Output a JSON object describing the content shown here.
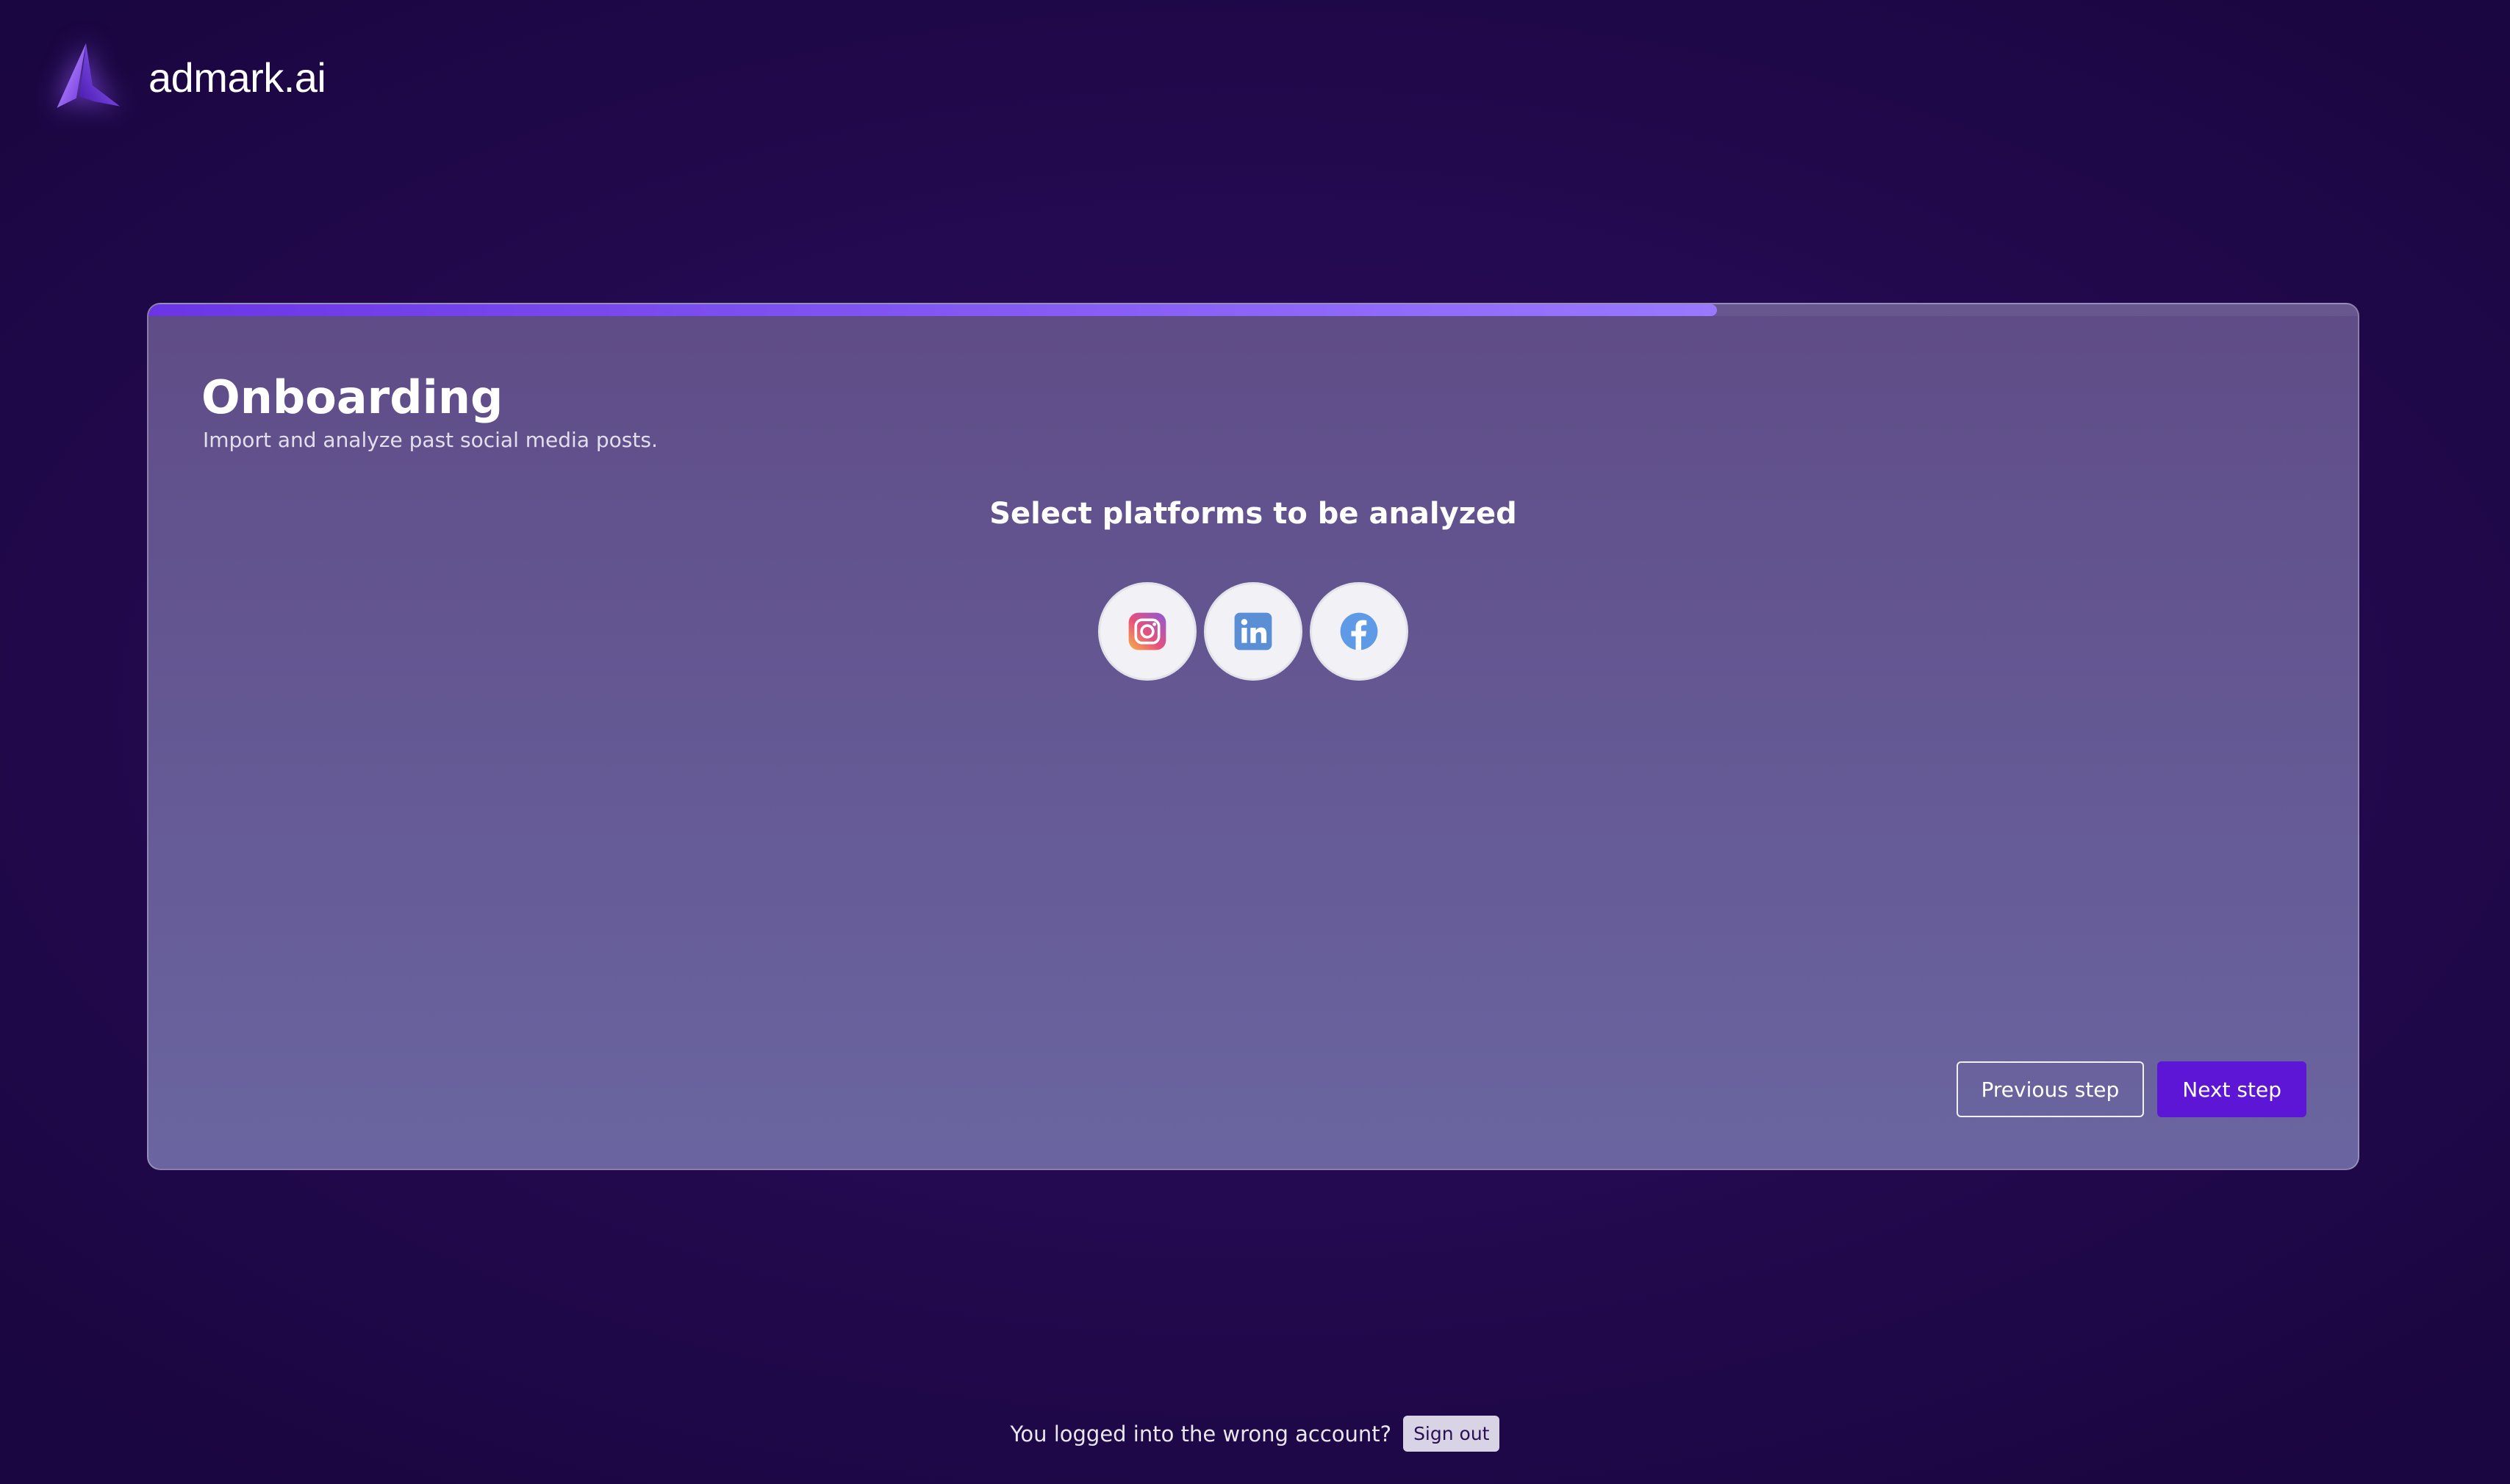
{
  "brand": {
    "name": "admark.ai",
    "logo_icon": "admark-logo-icon"
  },
  "onboarding": {
    "title": "Onboarding",
    "subtitle": "Import and analyze past social media posts.",
    "progress_percent": 71
  },
  "platforms": {
    "heading": "Select platforms to be analyzed",
    "items": [
      {
        "name": "Instagram",
        "icon": "instagram-icon"
      },
      {
        "name": "LinkedIn",
        "icon": "linkedin-icon"
      },
      {
        "name": "Facebook",
        "icon": "facebook-icon"
      }
    ]
  },
  "actions": {
    "previous_label": "Previous step",
    "next_label": "Next step"
  },
  "footer": {
    "prompt": "You logged into the wrong account?",
    "signout_label": "Sign out"
  },
  "colors": {
    "accent": "#5e16d6",
    "progress_start": "#6b35e6",
    "progress_end": "#9a78ff"
  }
}
